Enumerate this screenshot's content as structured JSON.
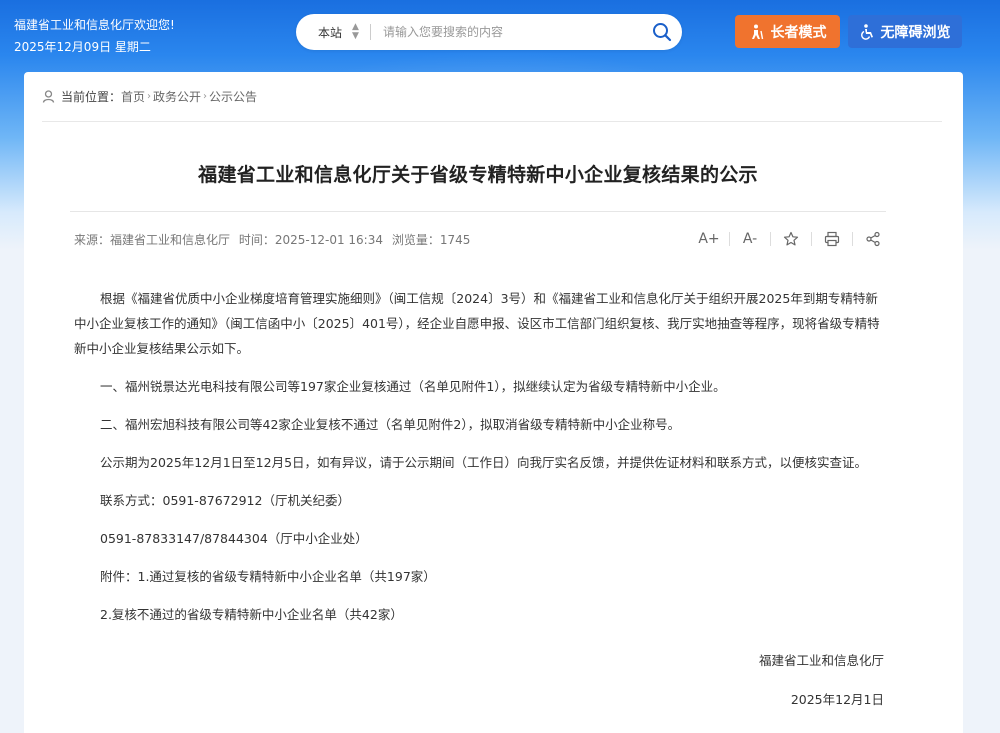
{
  "header": {
    "welcome": "福建省工业和信息化厅欢迎您!",
    "date": "2025年12月09日 星期二"
  },
  "search": {
    "scope": "本站",
    "placeholder": "请输入您要搜索的内容"
  },
  "buttons": {
    "elder_mode": "长者模式",
    "accessibility": "无障碍浏览"
  },
  "breadcrumb": {
    "label": "当前位置：",
    "items": [
      "首页",
      "政务公开",
      "公示公告"
    ]
  },
  "article": {
    "title": "福建省工业和信息化厅关于省级专精特新中小企业复核结果的公示",
    "meta": {
      "source": "来源：福建省工业和信息化厅",
      "time": "时间：2025-12-01 16:34",
      "views": "浏览量：1745"
    },
    "tools": {
      "font_increase": "A+",
      "font_decrease": "A-"
    },
    "paragraphs": [
      "根据《福建省优质中小企业梯度培育管理实施细则》（闽工信规〔2024〕3号）和《福建省工业和信息化厅关于组织开展2025年到期专精特新中小企业复核工作的通知》（闽工信函中小〔2025〕401号），经企业自愿申报、设区市工信部门组织复核、我厅实地抽查等程序，现将省级专精特新中小企业复核结果公示如下。",
      "一、福州锐景达光电科技有限公司等197家企业复核通过（名单见附件1），拟继续认定为省级专精特新中小企业。",
      "二、福州宏旭科技有限公司等42家企业复核不通过（名单见附件2），拟取消省级专精特新中小企业称号。",
      "公示期为2025年12月1日至12月5日，如有异议，请于公示期间（工作日）向我厅实名反馈，并提供佐证材料和联系方式，以便核实查证。",
      "联系方式：0591-87672912（厅机关纪委）",
      "0591-87833147/87844304（厅中小企业处）",
      "附件：1.通过复核的省级专精特新中小企业名单（共197家）",
      "2.复核不通过的省级专精特新中小企业名单（共42家）"
    ],
    "signature": {
      "org": "福建省工业和信息化厅",
      "date": "2025年12月1日"
    }
  },
  "colors": {
    "elder_button": "#f0732e",
    "access_button": "#2e6fd8",
    "header_blue": "#1a6fe0"
  }
}
